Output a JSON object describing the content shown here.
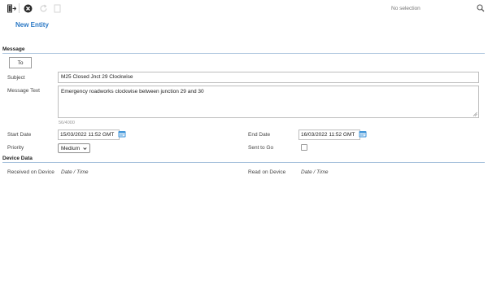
{
  "toolbar": {
    "search": {
      "placeholder": "No selection"
    }
  },
  "page": {
    "title": "New Entity"
  },
  "message_section": {
    "title": "Message",
    "to_label": "To",
    "subject_label": "Subject",
    "subject_value": "M25 Closed Jnct 29 Clockwise",
    "message_text_label": "Message Text",
    "message_text_value": "Emergency roadworks clockwise between junction 29 and 30",
    "char_count": "56/4000",
    "start_date_label": "Start Date",
    "start_date_value": "15/03/2022 11:52 GMT",
    "end_date_label": "End Date",
    "end_date_value": "16/03/2022 11:52 GMT",
    "priority_label": "Priority",
    "priority_value": "Medium",
    "sent_to_go_label": "Sent to Go",
    "sent_to_go_checked": false
  },
  "device_section": {
    "title": "Device Data",
    "received_label": "Received on Device",
    "received_value": "Date / Time",
    "read_label": "Read on Device",
    "read_value": "Date / Time"
  },
  "colors": {
    "accent": "#2a78c5",
    "section_rule": "#a9c3dd"
  }
}
